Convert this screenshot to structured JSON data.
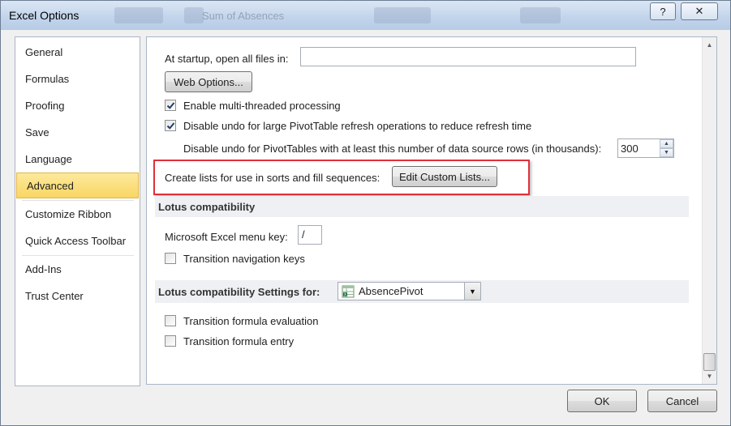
{
  "window": {
    "title": "Excel Options",
    "background_title": "Sum of Absences",
    "help_button": "?",
    "close_button": "✕"
  },
  "sidebar": {
    "items": [
      {
        "label": "General"
      },
      {
        "label": "Formulas"
      },
      {
        "label": "Proofing"
      },
      {
        "label": "Save"
      },
      {
        "label": "Language"
      },
      {
        "label": "Advanced",
        "selected": true
      },
      {
        "label": "Customize Ribbon"
      },
      {
        "label": "Quick Access Toolbar"
      },
      {
        "label": "Add-Ins"
      },
      {
        "label": "Trust Center"
      }
    ]
  },
  "advanced": {
    "startup_label": "At startup, open all files in:",
    "startup_value": "",
    "web_options_button": "Web Options...",
    "multithread_label": "Enable multi-threaded processing",
    "multithread_checked": true,
    "disable_undo_label": "Disable undo for large PivotTable refresh operations to reduce refresh time",
    "disable_undo_checked": true,
    "undo_rows_label": "Disable undo for PivotTables with at least this number of data source rows (in thousands):",
    "undo_rows_value": "300",
    "custom_lists_label": "Create lists for use in sorts and fill sequences:",
    "custom_lists_button": "Edit Custom Lists...",
    "highlight_color": "#e0303a"
  },
  "lotus": {
    "section_title": "Lotus compatibility",
    "menu_key_label": "Microsoft Excel menu key:",
    "menu_key_value": "/",
    "transition_nav_label": "Transition navigation keys",
    "transition_nav_checked": false
  },
  "lotus_settings": {
    "section_title": "Lotus compatibility Settings for:",
    "sheet_value": "AbsencePivot",
    "sheet_icon": "excel-sheet-icon",
    "formula_eval_label": "Transition formula evaluation",
    "formula_eval_checked": false,
    "formula_entry_label": "Transition formula entry",
    "formula_entry_checked": false
  },
  "footer": {
    "ok_button": "OK",
    "cancel_button": "Cancel"
  }
}
